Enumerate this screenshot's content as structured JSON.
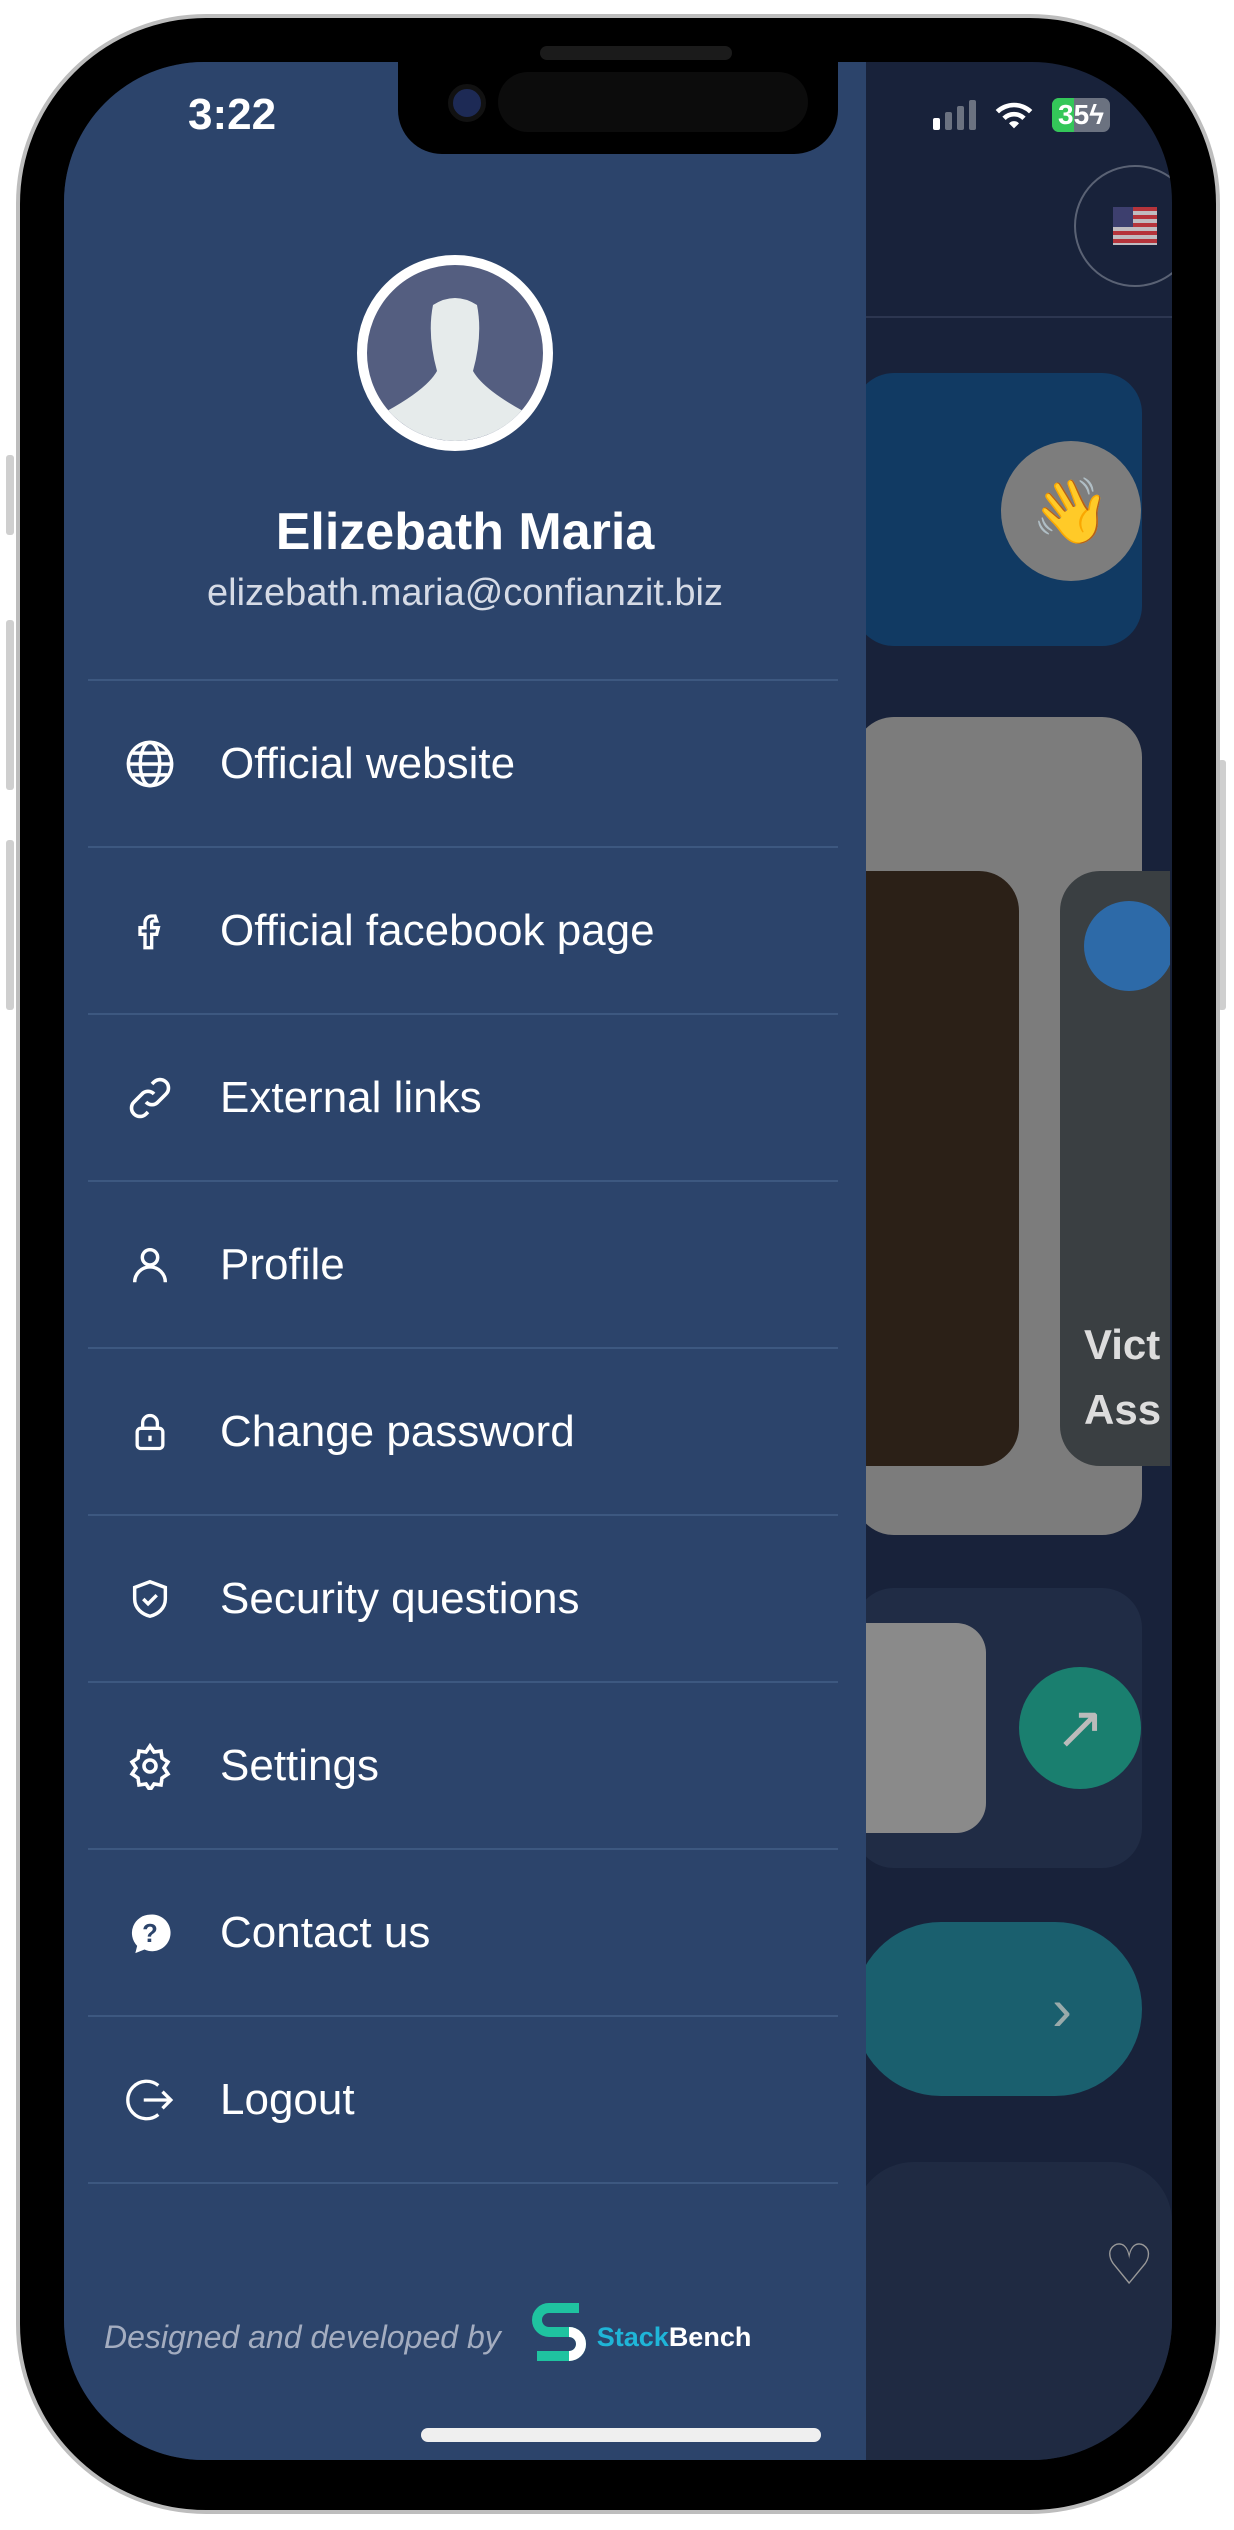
{
  "status_bar": {
    "time": "3:22",
    "battery": "35"
  },
  "profile": {
    "name": "Elizebath Maria",
    "email": "elizebath.maria@confianzit.biz"
  },
  "menu": [
    {
      "label": "Official website",
      "icon": "globe-icon"
    },
    {
      "label": "Official facebook page",
      "icon": "facebook-icon"
    },
    {
      "label": "External links",
      "icon": "link-icon"
    },
    {
      "label": "Profile",
      "icon": "user-icon"
    },
    {
      "label": "Change password",
      "icon": "lock-icon"
    },
    {
      "label": "Security questions",
      "icon": "shield-check-icon"
    },
    {
      "label": "Settings",
      "icon": "gear-icon"
    },
    {
      "label": "Contact us",
      "icon": "question-bubble-icon"
    },
    {
      "label": "Logout",
      "icon": "logout-icon"
    }
  ],
  "footer": {
    "text": "Designed and developed by",
    "brand_a": "Stack",
    "brand_b": "Bench"
  },
  "background": {
    "card_text_1": "Vict",
    "card_text_2": "Ass"
  },
  "colors": {
    "drawer": "#2c446b",
    "background": "#18223a",
    "accent": "#1fb5d8",
    "teal": "#1a7f87"
  }
}
